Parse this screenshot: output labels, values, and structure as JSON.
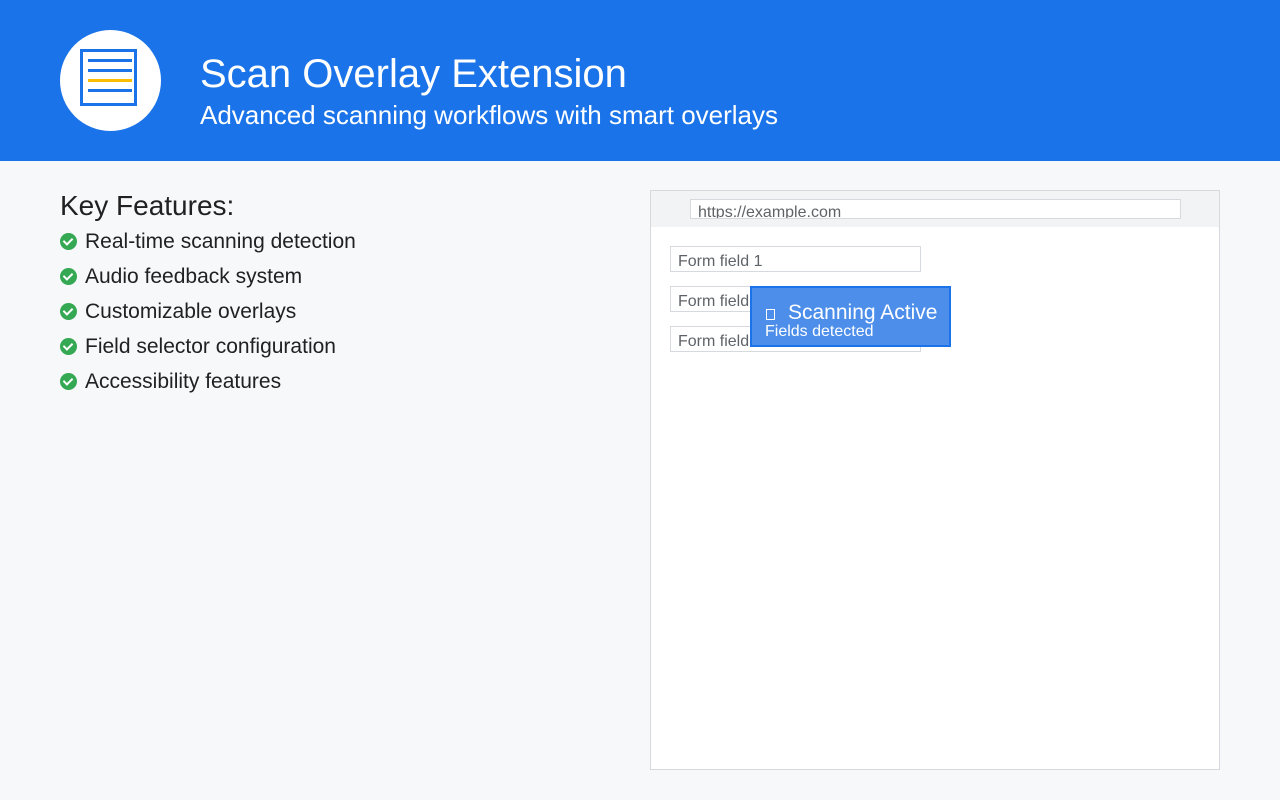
{
  "header": {
    "title": "Scan Overlay Extension",
    "subtitle": "Advanced scanning workflows with smart overlays",
    "background_color": "#1a73e8",
    "logo_icon": "document-icon"
  },
  "features": {
    "title": "Key Features:",
    "items": [
      "Real-time scanning detection",
      "Audio feedback system",
      "Customizable overlays",
      "Field selector configuration",
      "Accessibility features"
    ],
    "check_color": "#34a853"
  },
  "browser": {
    "url": "https://example.com",
    "fields": [
      "Form field 1",
      "Form field 2",
      "Form field 3"
    ],
    "overlay": {
      "icon": "scan-icon",
      "title": "Scanning Active",
      "subtitle": "Fields detected",
      "color": "#4c8eea"
    }
  }
}
